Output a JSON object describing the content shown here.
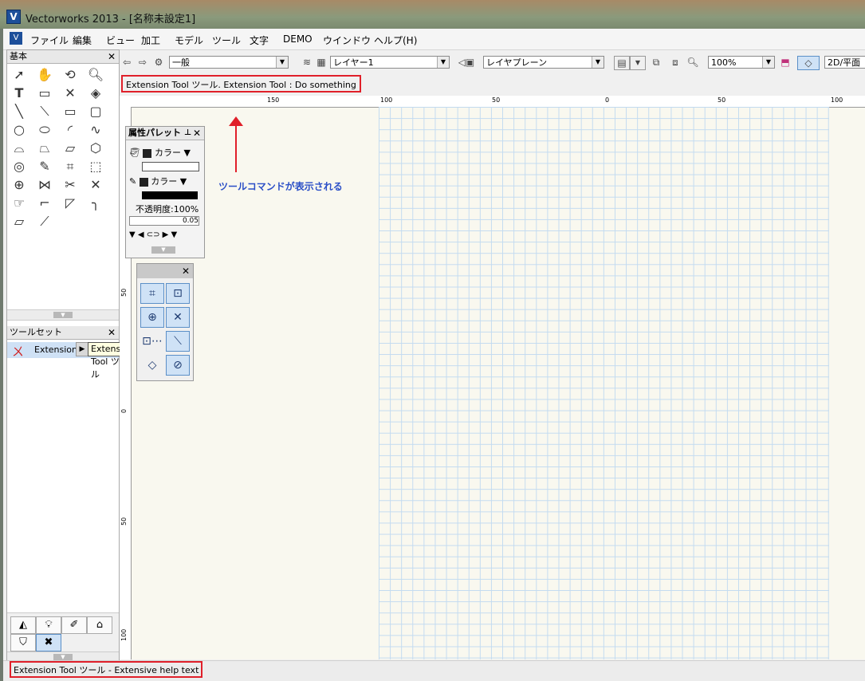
{
  "window": {
    "title": "Vectorworks 2013 - [名称未設定1]"
  },
  "menu": [
    "ファイル",
    "編集",
    "ビュー",
    "加工",
    "モデル",
    "ツール",
    "文字",
    "DEMO",
    "ウインドウ",
    "ヘルプ(H)"
  ],
  "toolbar": {
    "class_value": "一般",
    "layer_value": "レイヤー1",
    "plane_value": "レイヤプレーン",
    "zoom_value": "100%",
    "view_value": "2D/平面"
  },
  "mode_bar": {
    "message": "Extension Tool ツール. Extension Tool : Do something"
  },
  "palettes": {
    "basic": {
      "title": "基本"
    },
    "toolset": {
      "title": "ツールセット",
      "item_label": "Extension Tool"
    },
    "tooltip": "Extension Tool ツール",
    "attributes": {
      "title": "属性パレット",
      "fill_label": "カラー",
      "pen_label": "カラー",
      "opacity": "不透明度:100%",
      "line_weight": "0.05"
    }
  },
  "rulers": {
    "top": [
      "150",
      "100",
      "50",
      "0",
      "50",
      "100"
    ],
    "left": [
      "50",
      "0",
      "50",
      "100"
    ]
  },
  "annotation": {
    "text": "ツールコマンドが表示される",
    "color": "#2b4fc7"
  },
  "status_bar": {
    "message": "Extension Tool ツール - Extensive help text"
  },
  "colors": {
    "highlight_box": "#e0202a",
    "grid": "#c3dbf0",
    "canvas": "#f9f8ef"
  }
}
